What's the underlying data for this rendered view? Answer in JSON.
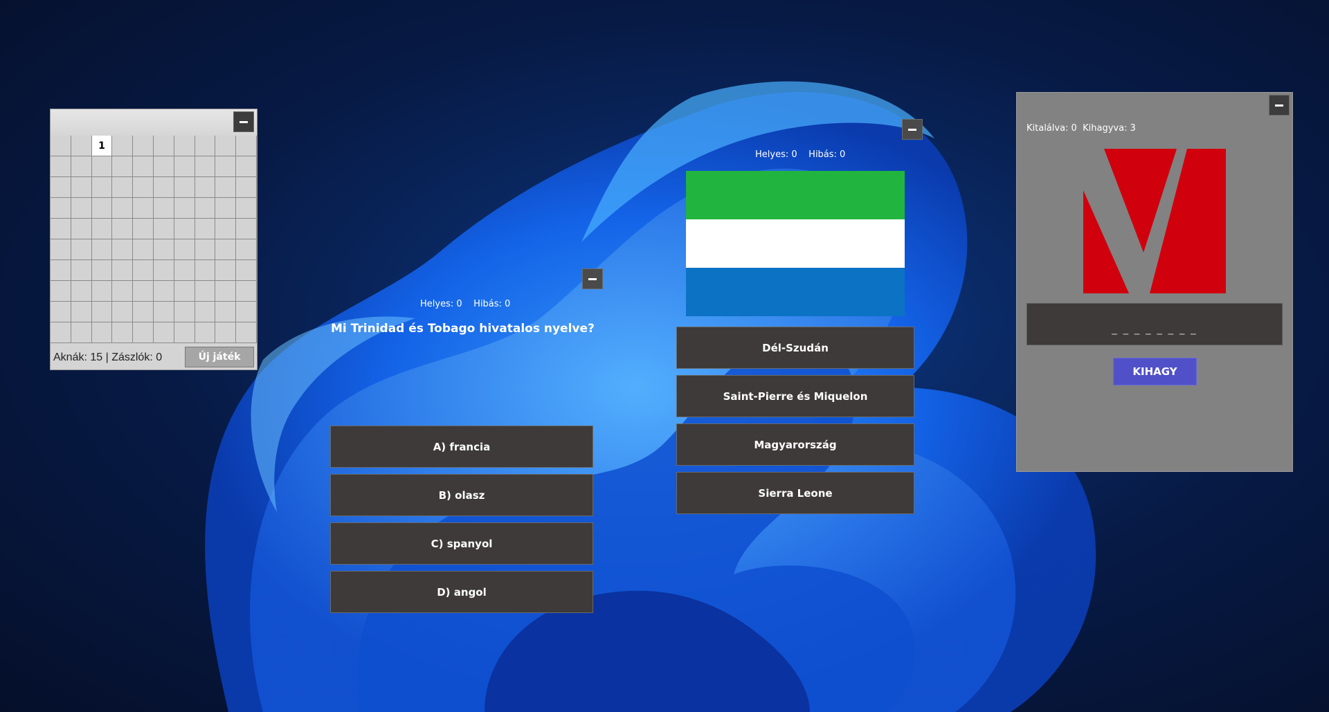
{
  "minesweeper": {
    "cells": [
      "",
      "",
      "1",
      "",
      "",
      "",
      "",
      "",
      "",
      "",
      "",
      "",
      "",
      "",
      "",
      "",
      "",
      "",
      "",
      "",
      "",
      "",
      "",
      "",
      "",
      "",
      "",
      "",
      "",
      "",
      "",
      "",
      "",
      "",
      "",
      "",
      "",
      "",
      "",
      "",
      "",
      "",
      "",
      "",
      "",
      "",
      "",
      "",
      "",
      "",
      "",
      "",
      "",
      "",
      "",
      "",
      "",
      "",
      "",
      "",
      "",
      "",
      "",
      "",
      "",
      "",
      "",
      "",
      "",
      "",
      "",
      "",
      "",
      "",
      "",
      "",
      "",
      "",
      "",
      "",
      "",
      "",
      "",
      "",
      "",
      "",
      "",
      "",
      "",
      "",
      "",
      "",
      "",
      "",
      "",
      "",
      "",
      "",
      "",
      ""
    ],
    "status": "Aknák: 15 | Zászlók: 0",
    "new_game_label": "Új játék"
  },
  "quiz": {
    "score": "Helyes: 0    Hibás: 0",
    "question": "Mi Trinidad és Tobago hivatalos nyelve?",
    "answers": [
      "A) francia",
      "B) olasz",
      "C) spanyol",
      "D) angol"
    ]
  },
  "flag_quiz": {
    "score": "Helyes: 0    Hibás: 0",
    "flag_colors": [
      "#21b53f",
      "#ffffff",
      "#0c72c4"
    ],
    "answers": [
      "Dél-Szudán",
      "Saint-Pierre és Miquelon",
      "Magyarország",
      "Sierra Leone"
    ]
  },
  "logo_quiz": {
    "stats": "Kitalálva: 0  Kihagyva: 3",
    "answer_mask": "_ _ _ _ _ _ _ _",
    "skip_label": "KIHAGY",
    "logo_color": "#d0000d"
  }
}
